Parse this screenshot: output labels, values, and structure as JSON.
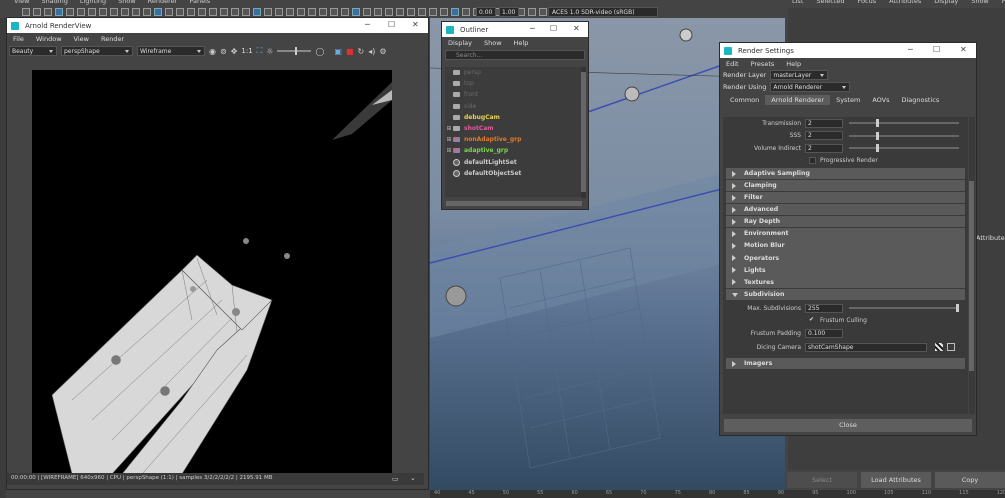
{
  "top_menu": [
    "View",
    "Shading",
    "Lighting",
    "Show",
    "Renderer",
    "Panels"
  ],
  "viewport_fields": [
    "0.00",
    "1.00"
  ],
  "color_space": "ACES 1.0 SDR-video (sRGB)",
  "right_panel": {
    "menu": [
      "List",
      "Selected",
      "Focus",
      "Attributes",
      "Display",
      "Show",
      "Help"
    ],
    "side_tab": "Attributes",
    "buttons": [
      "Select",
      "Load Attributes",
      "Copy"
    ]
  },
  "ruler_ticks": [
    "40",
    "45",
    "50",
    "55",
    "60",
    "65",
    "70",
    "75",
    "80",
    "85",
    "90",
    "95",
    "100",
    "105",
    "110",
    "115",
    "120"
  ],
  "render_view": {
    "title": "Arnold RenderView",
    "menu": [
      "File",
      "Window",
      "View",
      "Render"
    ],
    "aov": "Beauty",
    "camera": "perspShape",
    "display_mode": "Wireframe",
    "ratio": "1:1",
    "status": "00:00:00 | [WIREFRAME]  640x960 | CPU | perspShape (1:1) | samples 3/2/2/2/2/2 | 2195.91 MB"
  },
  "outliner": {
    "title": "Outliner",
    "menu": [
      "Display",
      "Show",
      "Help"
    ],
    "search_placeholder": "Search...",
    "items": [
      {
        "label": "persp",
        "color": "#6a6a6a",
        "expand": "",
        "icon": "camera"
      },
      {
        "label": "top",
        "color": "#6a6a6a",
        "expand": "",
        "icon": "camera"
      },
      {
        "label": "front",
        "color": "#6a6a6a",
        "expand": "",
        "icon": "camera"
      },
      {
        "label": "side",
        "color": "#6a6a6a",
        "expand": "",
        "icon": "camera"
      },
      {
        "label": "debugCam",
        "color": "#e8d34a",
        "expand": "",
        "icon": "camera"
      },
      {
        "label": "shotCam",
        "color": "#e05a9a",
        "expand": "⊞",
        "icon": "camera"
      },
      {
        "label": "nonAdaptive_grp",
        "color": "#e07a2a",
        "expand": "⊞",
        "icon": "group"
      },
      {
        "label": "adaptive_grp",
        "color": "#7ad84a",
        "expand": "⊞",
        "icon": "group"
      },
      {
        "label": "defaultLightSet",
        "color": "#cccccc",
        "expand": "",
        "icon": "set"
      },
      {
        "label": "defaultObjectSet",
        "color": "#cccccc",
        "expand": "",
        "icon": "set"
      }
    ]
  },
  "render_settings": {
    "title": "Render Settings",
    "menu": [
      "Edit",
      "Presets",
      "Help"
    ],
    "render_layer_label": "Render Layer",
    "render_layer": "masterLayer",
    "render_using_label": "Render Using",
    "render_using": "Arnold Renderer",
    "tabs": [
      "Common",
      "Arnold Renderer",
      "System",
      "AOVs",
      "Diagnostics"
    ],
    "active_tab": "Arnold Renderer",
    "ray_depth_rows": [
      {
        "label": "Transmission",
        "value": "2",
        "slider": 0.25
      },
      {
        "label": "SSS",
        "value": "2",
        "slider": 0.25
      },
      {
        "label": "Volume Indirect",
        "value": "2",
        "slider": 0.25
      }
    ],
    "progressive_render": "Progressive Render",
    "sections_top": [
      "Adaptive Sampling",
      "Clamping",
      "Filter",
      "Advanced",
      "Ray Depth",
      "Environment",
      "Motion Blur",
      "Operators",
      "Lights",
      "Textures"
    ],
    "subdivision": {
      "header": "Subdivision",
      "max_subdiv_label": "Max. Subdivisions",
      "max_subdiv_value": "255",
      "max_subdiv_slider": 1.0,
      "frustum_culling": "Frustum Culling",
      "frustum_padding_label": "Frustum Padding",
      "frustum_padding_value": "0.100",
      "dicing_camera_label": "Dicing Camera",
      "dicing_camera_value": "shotCamShape"
    },
    "sections_bottom": [
      "Imagers"
    ],
    "close_label": "Close"
  }
}
